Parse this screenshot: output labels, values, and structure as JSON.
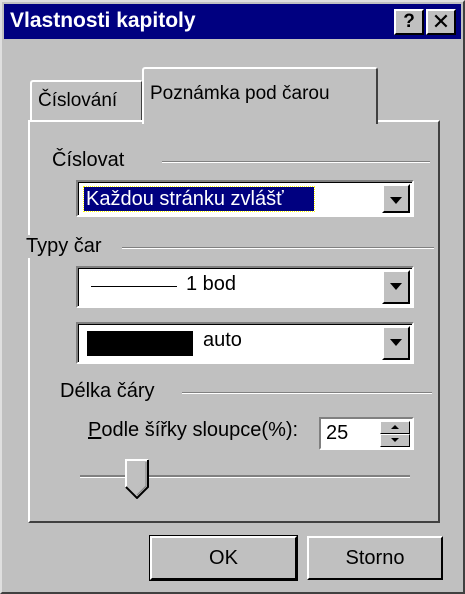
{
  "window": {
    "title": "Vlastnosti kapitoly",
    "help_label": "?",
    "close_label": "✕"
  },
  "tabs": [
    {
      "label": "Číslování",
      "active": false
    },
    {
      "label": "Poznámka pod čarou",
      "active": true
    }
  ],
  "numbering": {
    "group_label": "Číslovat",
    "selected": "Každou stránku zvlášť"
  },
  "line_types": {
    "group_label": "Typy čar",
    "width_selected": "1 bod",
    "color_selected": "auto",
    "color_swatch": "#000000"
  },
  "line_length": {
    "group_label": "Délka čáry",
    "field_label_mnemonic": "P",
    "field_label_rest": "odle šířky sloupce(%):",
    "value": "25"
  },
  "buttons": {
    "ok": "OK",
    "cancel": "Storno"
  },
  "colors": {
    "titlebar": "#000080",
    "face": "#c0c0c0",
    "selection": "#000080"
  },
  "icons": {
    "dropdown": "chevron-down-icon",
    "spin_up": "spin-up-icon",
    "spin_down": "spin-down-icon",
    "slider_thumb": "slider-thumb-icon"
  }
}
